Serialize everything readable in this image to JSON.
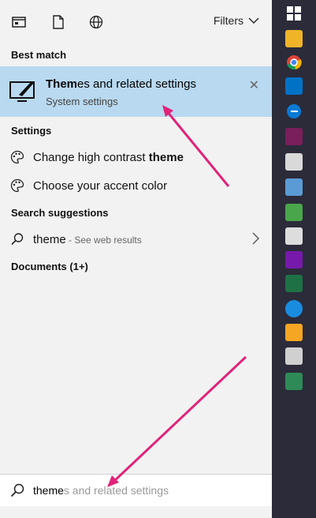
{
  "filters": {
    "label": "Filters"
  },
  "best_match": {
    "heading": "Best match",
    "title_highlight": "Them",
    "title_rest": "es and related settings",
    "subtitle": "System settings",
    "close_glyph": "✕"
  },
  "settings": {
    "heading": "Settings",
    "items": [
      {
        "label_prefix": "Change high contrast ",
        "label_bold": "theme",
        "icon": "palette-icon"
      },
      {
        "label_prefix": "Choose your accent color",
        "label_bold": "",
        "icon": "palette-icon"
      }
    ]
  },
  "suggestions": {
    "heading": "Search suggestions",
    "query": "theme",
    "hint": " - See web results"
  },
  "documents": {
    "heading": "Documents (1+)"
  },
  "search": {
    "typed": "theme",
    "completion": "s and related settings"
  },
  "colors": {
    "highlight": "#b9d9f0",
    "arrow": "#e0237a"
  }
}
